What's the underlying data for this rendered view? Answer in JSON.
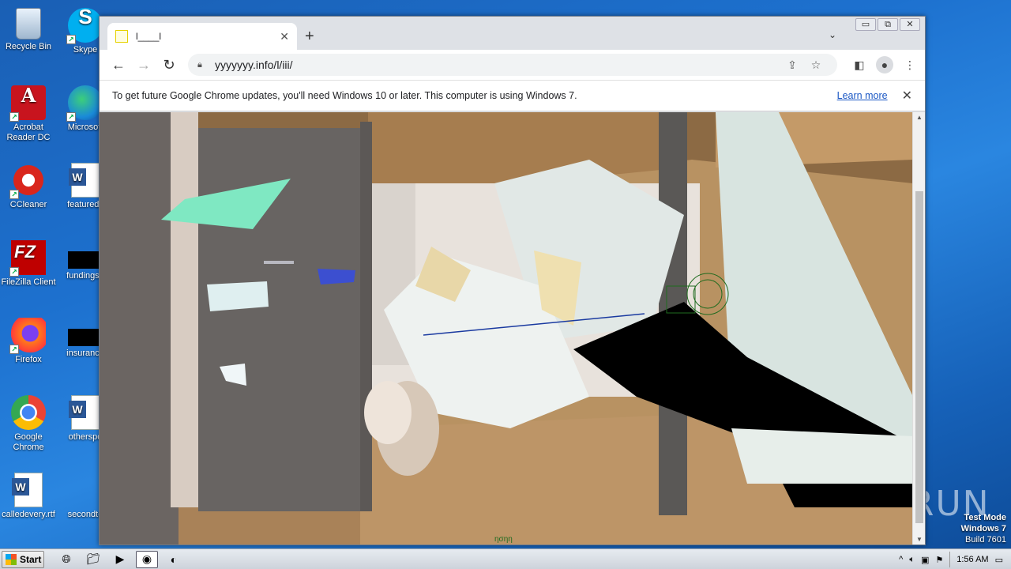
{
  "desktop": {
    "icons_left": [
      {
        "label": "Recycle Bin"
      },
      {
        "label": "Acrobat Reader DC"
      },
      {
        "label": "CCleaner"
      },
      {
        "label": "FileZilla Client"
      },
      {
        "label": "Firefox"
      },
      {
        "label": "Google Chrome"
      },
      {
        "label": "calledevery.rtf"
      }
    ],
    "icons_right": [
      {
        "label": "Skype"
      },
      {
        "label": "Microsoft"
      },
      {
        "label": "featureds"
      },
      {
        "label": "fundingse"
      },
      {
        "label": "insurance"
      },
      {
        "label": "otherspo"
      },
      {
        "label": "secondto"
      }
    ],
    "test_mode": {
      "line1": "Test Mode",
      "line2": "Windows 7",
      "line3": "Build 7601"
    },
    "watermark": "ANY RUN"
  },
  "browser": {
    "tab": {
      "title": "l____l",
      "close": "✕"
    },
    "new_tab": "+",
    "tab_menu": "⌄",
    "caption": {
      "minimize": "▭",
      "restore": "⧉",
      "close": "✕"
    },
    "nav": {
      "back": "←",
      "forward": "→",
      "reload": "↻"
    },
    "url": "yyyyyyy.info/l/iii/",
    "infobar": {
      "message": "To get future Google Chrome updates, you'll need Windows 10 or later. This computer is using Windows 7.",
      "link": "Learn more",
      "close": "✕"
    },
    "scene_caption": "ησηη"
  },
  "taskbar": {
    "start_label": "Start",
    "clock": "1:56 AM",
    "tray_chevron": "^"
  }
}
